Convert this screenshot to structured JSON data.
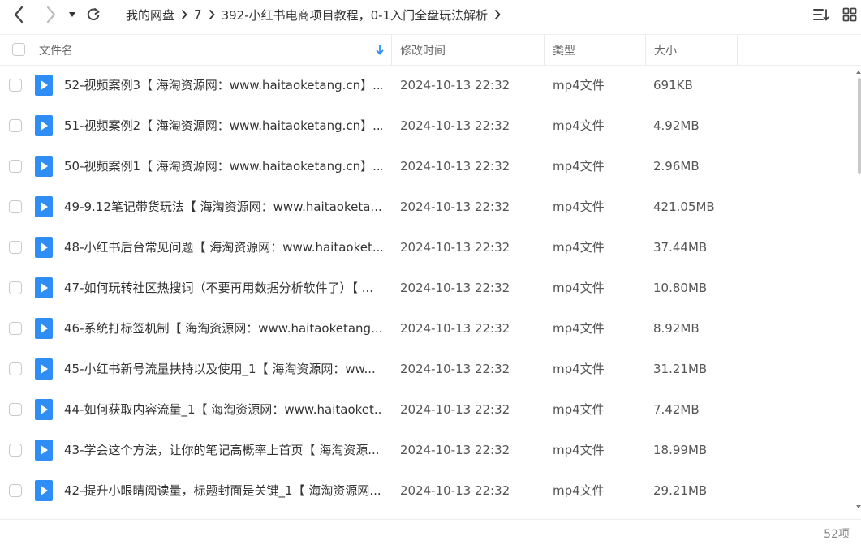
{
  "toolbar": {
    "back_icon": "chevron-left-icon",
    "forward_icon": "chevron-right-icon",
    "history_icon": "caret-down-icon",
    "refresh_icon": "refresh-icon",
    "sort_icon": "sort-list-icon",
    "view_icon": "grid-view-icon"
  },
  "breadcrumb": [
    "我的网盘",
    "7",
    "392-小红书电商项目教程，0-1入门全盘玩法解析"
  ],
  "columns": {
    "name": "文件名",
    "modified": "修改时间",
    "type": "类型",
    "size": "大小"
  },
  "files": [
    {
      "name": "52-视频案例3【 海淘资源网：www.haitaoketang.cn】....",
      "modified": "2024-10-13 22:32",
      "type": "mp4文件",
      "size": "691KB"
    },
    {
      "name": "51-视频案例2【 海淘资源网：www.haitaoketang.cn】....",
      "modified": "2024-10-13 22:32",
      "type": "mp4文件",
      "size": "4.92MB"
    },
    {
      "name": "50-视频案例1【 海淘资源网：www.haitaoketang.cn】....",
      "modified": "2024-10-13 22:32",
      "type": "mp4文件",
      "size": "2.96MB"
    },
    {
      "name": "49-9.12笔记带货玩法【 海淘资源网：www.haitaoketa...",
      "modified": "2024-10-13 22:32",
      "type": "mp4文件",
      "size": "421.05MB"
    },
    {
      "name": "48-小红书后台常见问题【 海淘资源网：www.haitaoket...",
      "modified": "2024-10-13 22:32",
      "type": "mp4文件",
      "size": "37.44MB"
    },
    {
      "name": "47-如何玩转社区热搜词（不要再用数据分析软件了）【 ...",
      "modified": "2024-10-13 22:32",
      "type": "mp4文件",
      "size": "10.80MB"
    },
    {
      "name": "46-系统打标签机制【 海淘资源网：www.haitaoketang....",
      "modified": "2024-10-13 22:32",
      "type": "mp4文件",
      "size": "8.92MB"
    },
    {
      "name": "45-小红书新号流量扶持以及使用_1【 海淘资源网：ww...",
      "modified": "2024-10-13 22:32",
      "type": "mp4文件",
      "size": "31.21MB"
    },
    {
      "name": "44-如何获取内容流量_1【 海淘资源网：www.haitaoket...",
      "modified": "2024-10-13 22:32",
      "type": "mp4文件",
      "size": "7.42MB"
    },
    {
      "name": "43-学会这个方法，让你的笔记高概率上首页【 海淘资源...",
      "modified": "2024-10-13 22:32",
      "type": "mp4文件",
      "size": "18.99MB"
    },
    {
      "name": "42-提升小眼睛阅读量，标题封面是关键_1【 海淘资源网...",
      "modified": "2024-10-13 22:32",
      "type": "mp4文件",
      "size": "29.21MB"
    }
  ],
  "footer": {
    "count": "52项"
  },
  "colors": {
    "accent": "#2f8ef5",
    "text": "#333333",
    "muted": "#888888",
    "border": "#eeeeee"
  }
}
